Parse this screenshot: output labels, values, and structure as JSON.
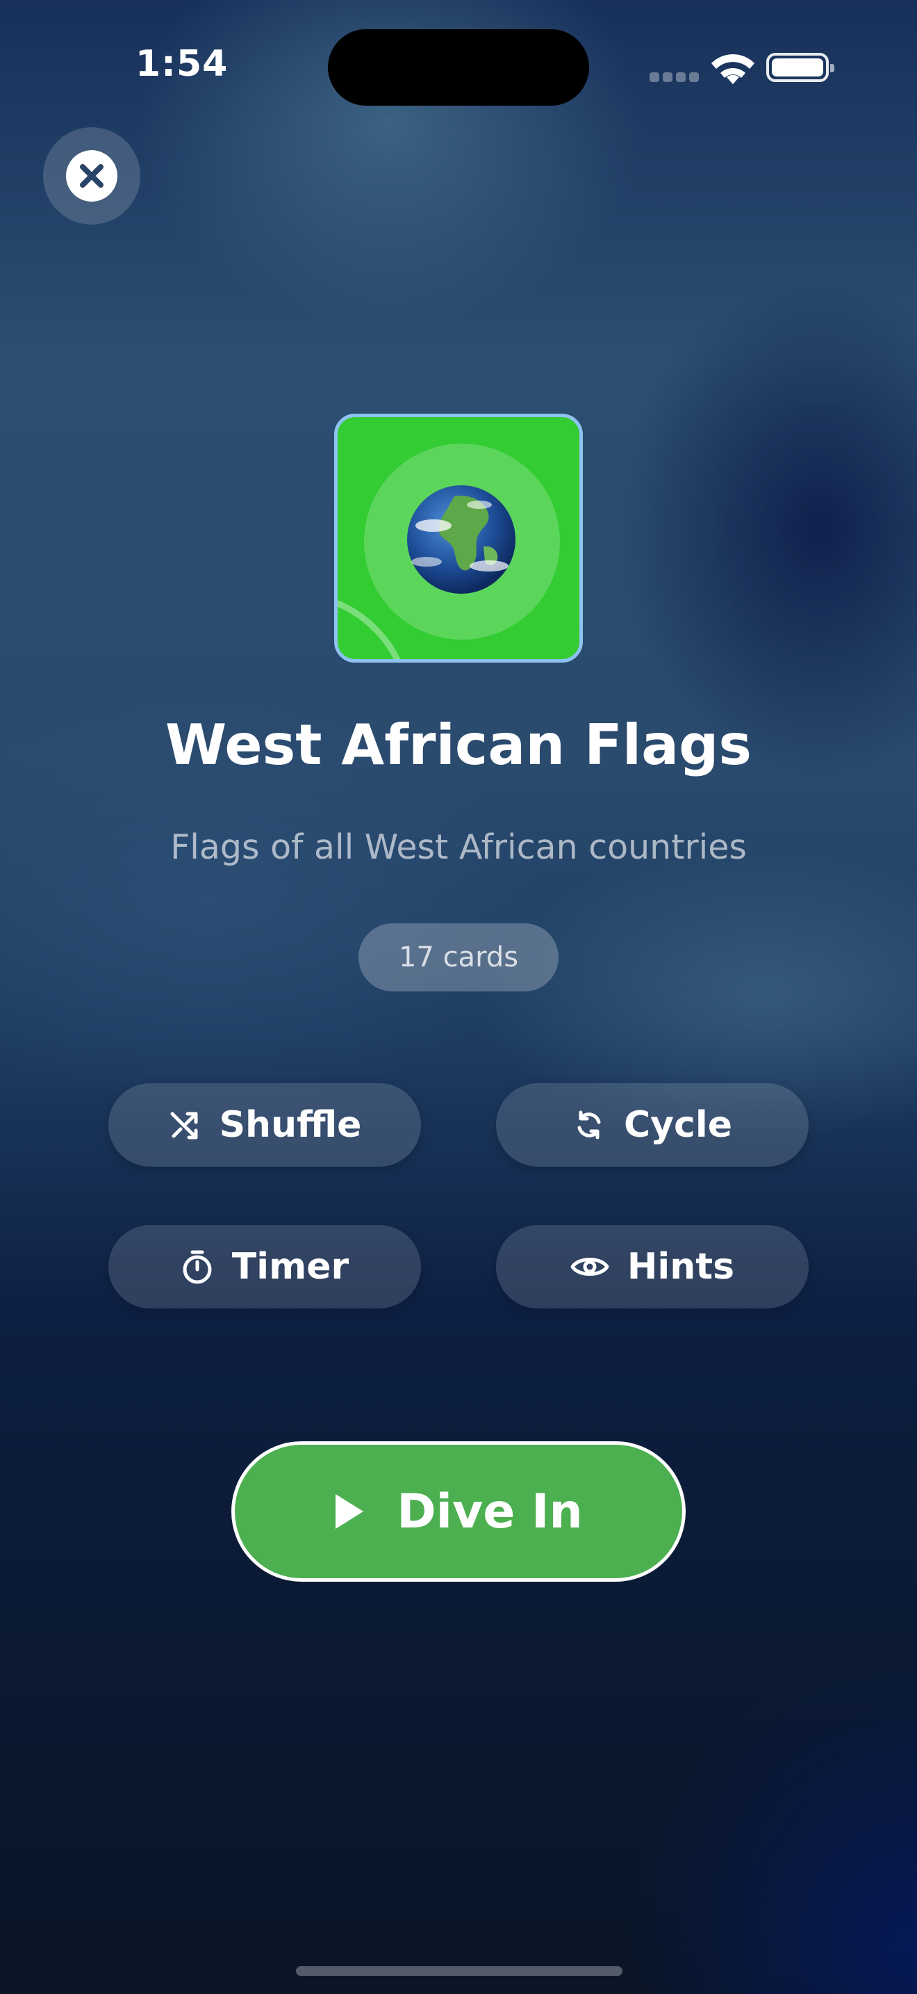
{
  "status_bar": {
    "time": "1:54"
  },
  "deck": {
    "title": "West African Flags",
    "subtitle": "Flags of all West African countries",
    "card_count": "17 cards",
    "icon": "globe-icon",
    "icon_bg_color": "#33cc33"
  },
  "options": {
    "shuffle": {
      "label": "Shuffle",
      "icon": "shuffle-icon"
    },
    "cycle": {
      "label": "Cycle",
      "icon": "cycle-icon"
    },
    "timer": {
      "label": "Timer",
      "icon": "timer-icon"
    },
    "hints": {
      "label": "Hints",
      "icon": "eye-icon"
    }
  },
  "primary_action": {
    "label": "Dive In",
    "icon": "play-icon",
    "color": "#4caf50"
  },
  "close": {
    "icon": "close-icon"
  }
}
